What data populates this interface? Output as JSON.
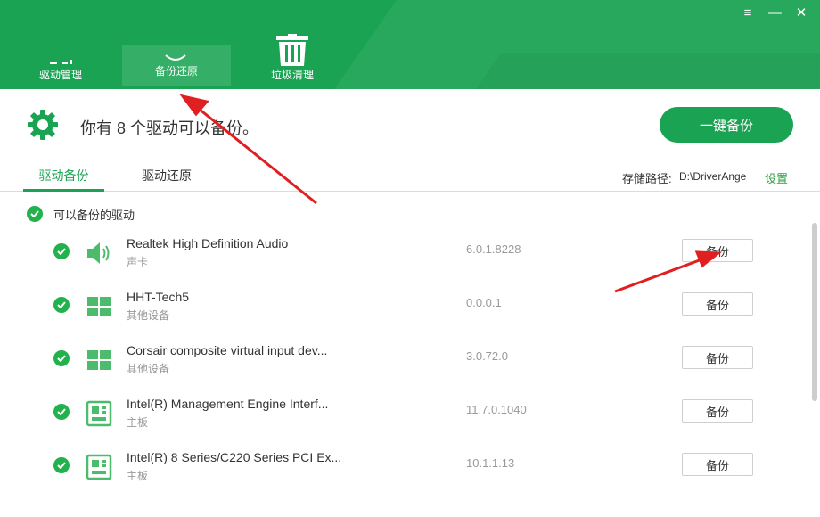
{
  "window": {
    "menu_icon": "menu-icon",
    "min_icon": "minimize-icon",
    "close_icon": "close-icon"
  },
  "nav": {
    "tabs": [
      {
        "label": "驱动管理",
        "icon": "driver-manage-icon"
      },
      {
        "label": "备份还原",
        "icon": "backup-restore-icon"
      },
      {
        "label": "垃圾清理",
        "icon": "trash-icon"
      }
    ]
  },
  "summary": {
    "text": "你有 8 个驱动可以备份。",
    "button": "一键备份"
  },
  "subtabs": {
    "backup": "驱动备份",
    "restore": "驱动还原"
  },
  "storage": {
    "label": "存储路径:",
    "path": "D:\\DriverAnge",
    "settings": "设置"
  },
  "section": {
    "title": "可以备份的驱动"
  },
  "drivers": [
    {
      "name": "Realtek High Definition Audio",
      "type": "声卡",
      "version": "6.0.1.8228",
      "button": "备份",
      "icon": "speaker-icon"
    },
    {
      "name": "HHT-Tech5",
      "type": "其他设备",
      "version": "0.0.0.1",
      "button": "备份",
      "icon": "windows-icon"
    },
    {
      "name": "Corsair composite virtual input dev...",
      "type": "其他设备",
      "version": "3.0.72.0",
      "button": "备份",
      "icon": "windows-icon"
    },
    {
      "name": "Intel(R) Management Engine Interf...",
      "type": "主板",
      "version": "11.7.0.1040",
      "button": "备份",
      "icon": "motherboard-icon"
    },
    {
      "name": "Intel(R) 8 Series/C220 Series PCI Ex...",
      "type": "主板",
      "version": "10.1.1.13",
      "button": "备份",
      "icon": "motherboard-icon"
    }
  ],
  "colors": {
    "brand": "#1aa353",
    "check": "#22b14c",
    "annotation": "#e02020"
  }
}
